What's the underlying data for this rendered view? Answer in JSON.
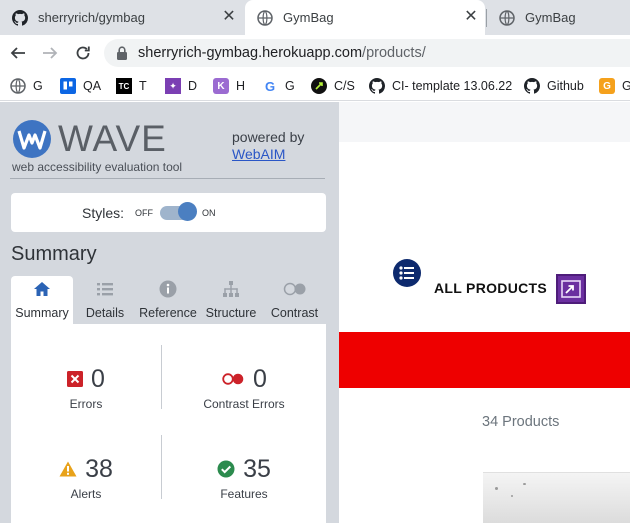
{
  "browser": {
    "tabs": [
      {
        "title": "sherryrich/gymbag",
        "active": false
      },
      {
        "title": "GymBag",
        "active": true
      },
      {
        "title": "GymBag",
        "active": false
      }
    ],
    "close_glyph": "✕",
    "url_host": "sherryrich-gymbag.herokuapp.com",
    "url_path": "/products/"
  },
  "bookmarks": [
    {
      "label": "G",
      "icon": "globe-icon"
    },
    {
      "label": "QA",
      "icon": "trello-icon"
    },
    {
      "label": "T",
      "icon": "tc-icon"
    },
    {
      "label": "D",
      "icon": "d-icon"
    },
    {
      "label": "H",
      "icon": "h-icon"
    },
    {
      "label": "G",
      "icon": "google-icon"
    },
    {
      "label": "C/S",
      "icon": "cs-icon"
    },
    {
      "label": "CI- template 13.06.22",
      "icon": "github-icon"
    },
    {
      "label": "Github",
      "icon": "github-icon"
    },
    {
      "label": "G",
      "icon": "g-orange-icon"
    }
  ],
  "wave": {
    "logo_text": "WAVE",
    "subtitle": "web accessibility evaluation tool",
    "powered_by": "powered by",
    "webaim": "WebAIM",
    "styles_label": "Styles:",
    "toggle_off": "OFF",
    "toggle_on": "ON",
    "toggle_state": "on",
    "summary_title": "Summary",
    "tabs": [
      {
        "label": "Summary",
        "icon": "home-icon",
        "active": true
      },
      {
        "label": "Details",
        "icon": "list-icon",
        "active": false
      },
      {
        "label": "Reference",
        "icon": "info-icon",
        "active": false
      },
      {
        "label": "Structure",
        "icon": "structure-icon",
        "active": false
      },
      {
        "label": "Contrast",
        "icon": "contrast-icon",
        "active": false
      }
    ],
    "stats": {
      "errors": {
        "count": "0",
        "label": "Errors"
      },
      "contrast_errors": {
        "count": "0",
        "label": "Contrast Errors"
      },
      "alerts": {
        "count": "38",
        "label": "Alerts"
      },
      "features": {
        "count": "35",
        "label": "Features"
      }
    }
  },
  "page": {
    "heading": "ALL PRODUCTS",
    "product_count": "34 Products",
    "accent_red": "#ee0000"
  }
}
